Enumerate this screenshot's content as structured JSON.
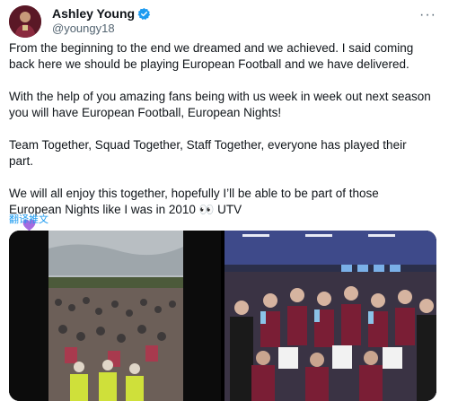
{
  "author": {
    "display_name": "Ashley Young",
    "handle": "@youngy18",
    "avatar_icon": "player-avatar"
  },
  "tweet": {
    "paragraphs": [
      "From the beginning to the end we dreamed and we achieved. I said coming back here we should be playing European Football and we have delivered.",
      "With the help of you amazing fans being with us week in week out next season you will have European Football, European Nights!",
      "Team Together, Squad Together, Staff Together, everyone has played their part.",
      "We will all enjoy this together, hopefully I’ll be able to be part of those European Nights like I was in 2010 👀 UTV"
    ],
    "translate_label": "翻译推文"
  },
  "media": [
    {
      "kind": "video",
      "subject": "crowd-of-fans"
    },
    {
      "kind": "photo",
      "subject": "team-dressing-room-celebration"
    }
  ],
  "colors": {
    "link_blue": "#1d9bf0",
    "verified_blue": "#1d9bf0",
    "purple_heart": "#a66be0",
    "blue_heart": "#5aa9e6",
    "claret": "#7a1e35"
  }
}
